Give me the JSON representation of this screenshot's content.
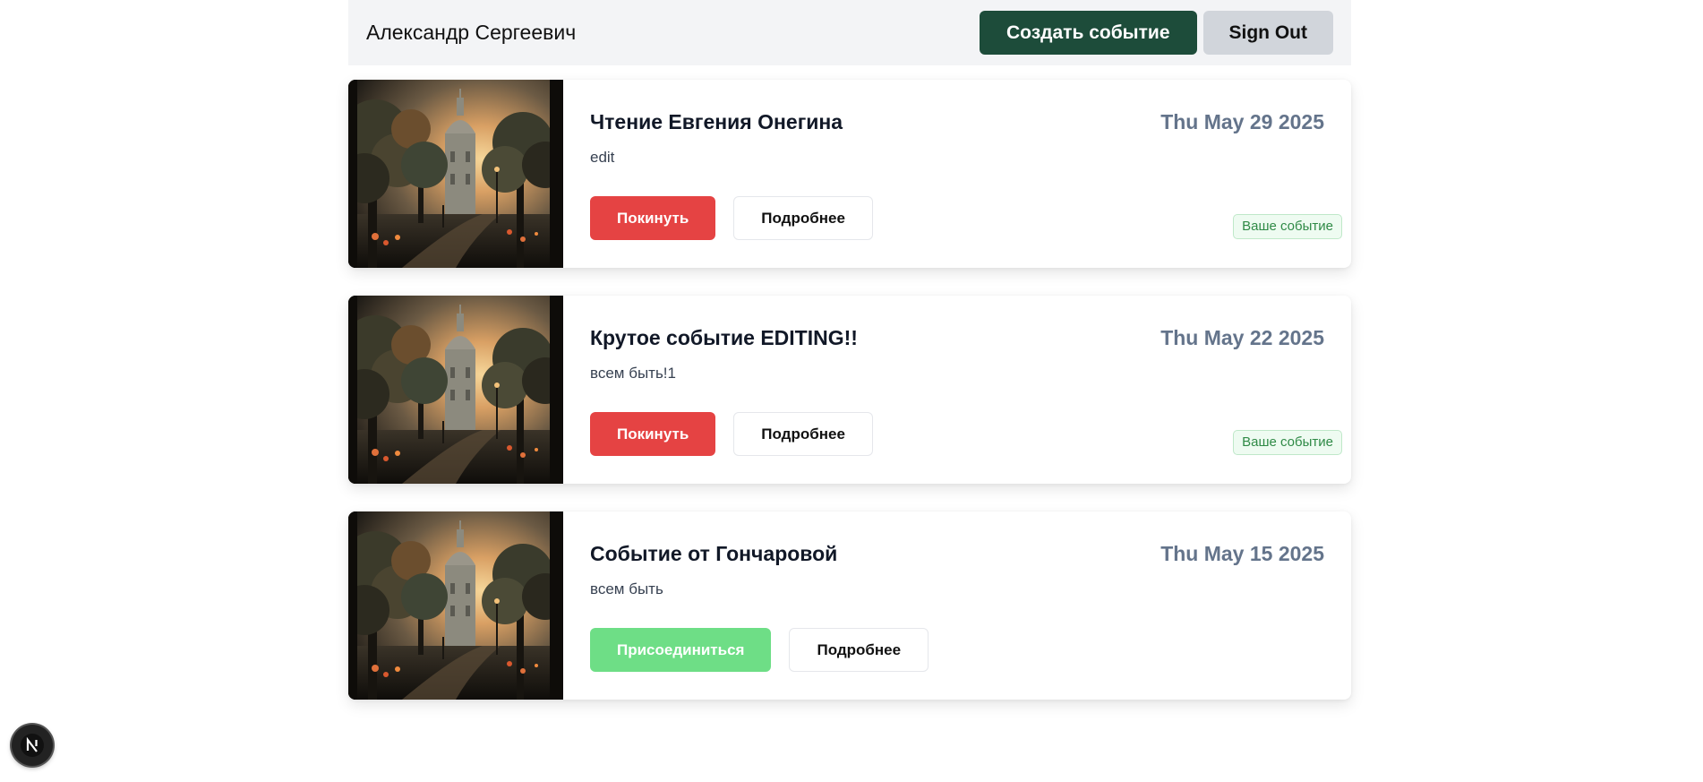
{
  "header": {
    "user_name": "Александр Сергеевич",
    "create_label": "Создать событие",
    "signout_label": "Sign Out"
  },
  "events": [
    {
      "title": "Чтение Евгения Онегина",
      "date": "Thu May 29 2025",
      "description": "edit",
      "primary_action": "Покинуть",
      "primary_kind": "leave",
      "details_label": "Подробнее",
      "badge": "Ваше событие"
    },
    {
      "title": "Крутое событие EDITING!!",
      "date": "Thu May 22 2025",
      "description": "всем быть!1",
      "primary_action": "Покинуть",
      "primary_kind": "leave",
      "details_label": "Подробнее",
      "badge": "Ваше событие"
    },
    {
      "title": "Событие от Гончаровой",
      "date": "Thu May 15 2025",
      "description": "всем быть",
      "primary_action": "Присоединиться",
      "primary_kind": "join",
      "details_label": "Подробнее",
      "badge": ""
    }
  ],
  "devtools": {
    "icon": "nextjs-logo-icon",
    "letter": "N"
  },
  "colors": {
    "header_bg": "#f3f4f6",
    "create_button": "#1d4c3a",
    "signout_button": "#d1d5db",
    "leave_button": "#e54343",
    "join_button": "#6ede86",
    "date_text": "#64748b",
    "badge_text": "#2f8a46"
  }
}
